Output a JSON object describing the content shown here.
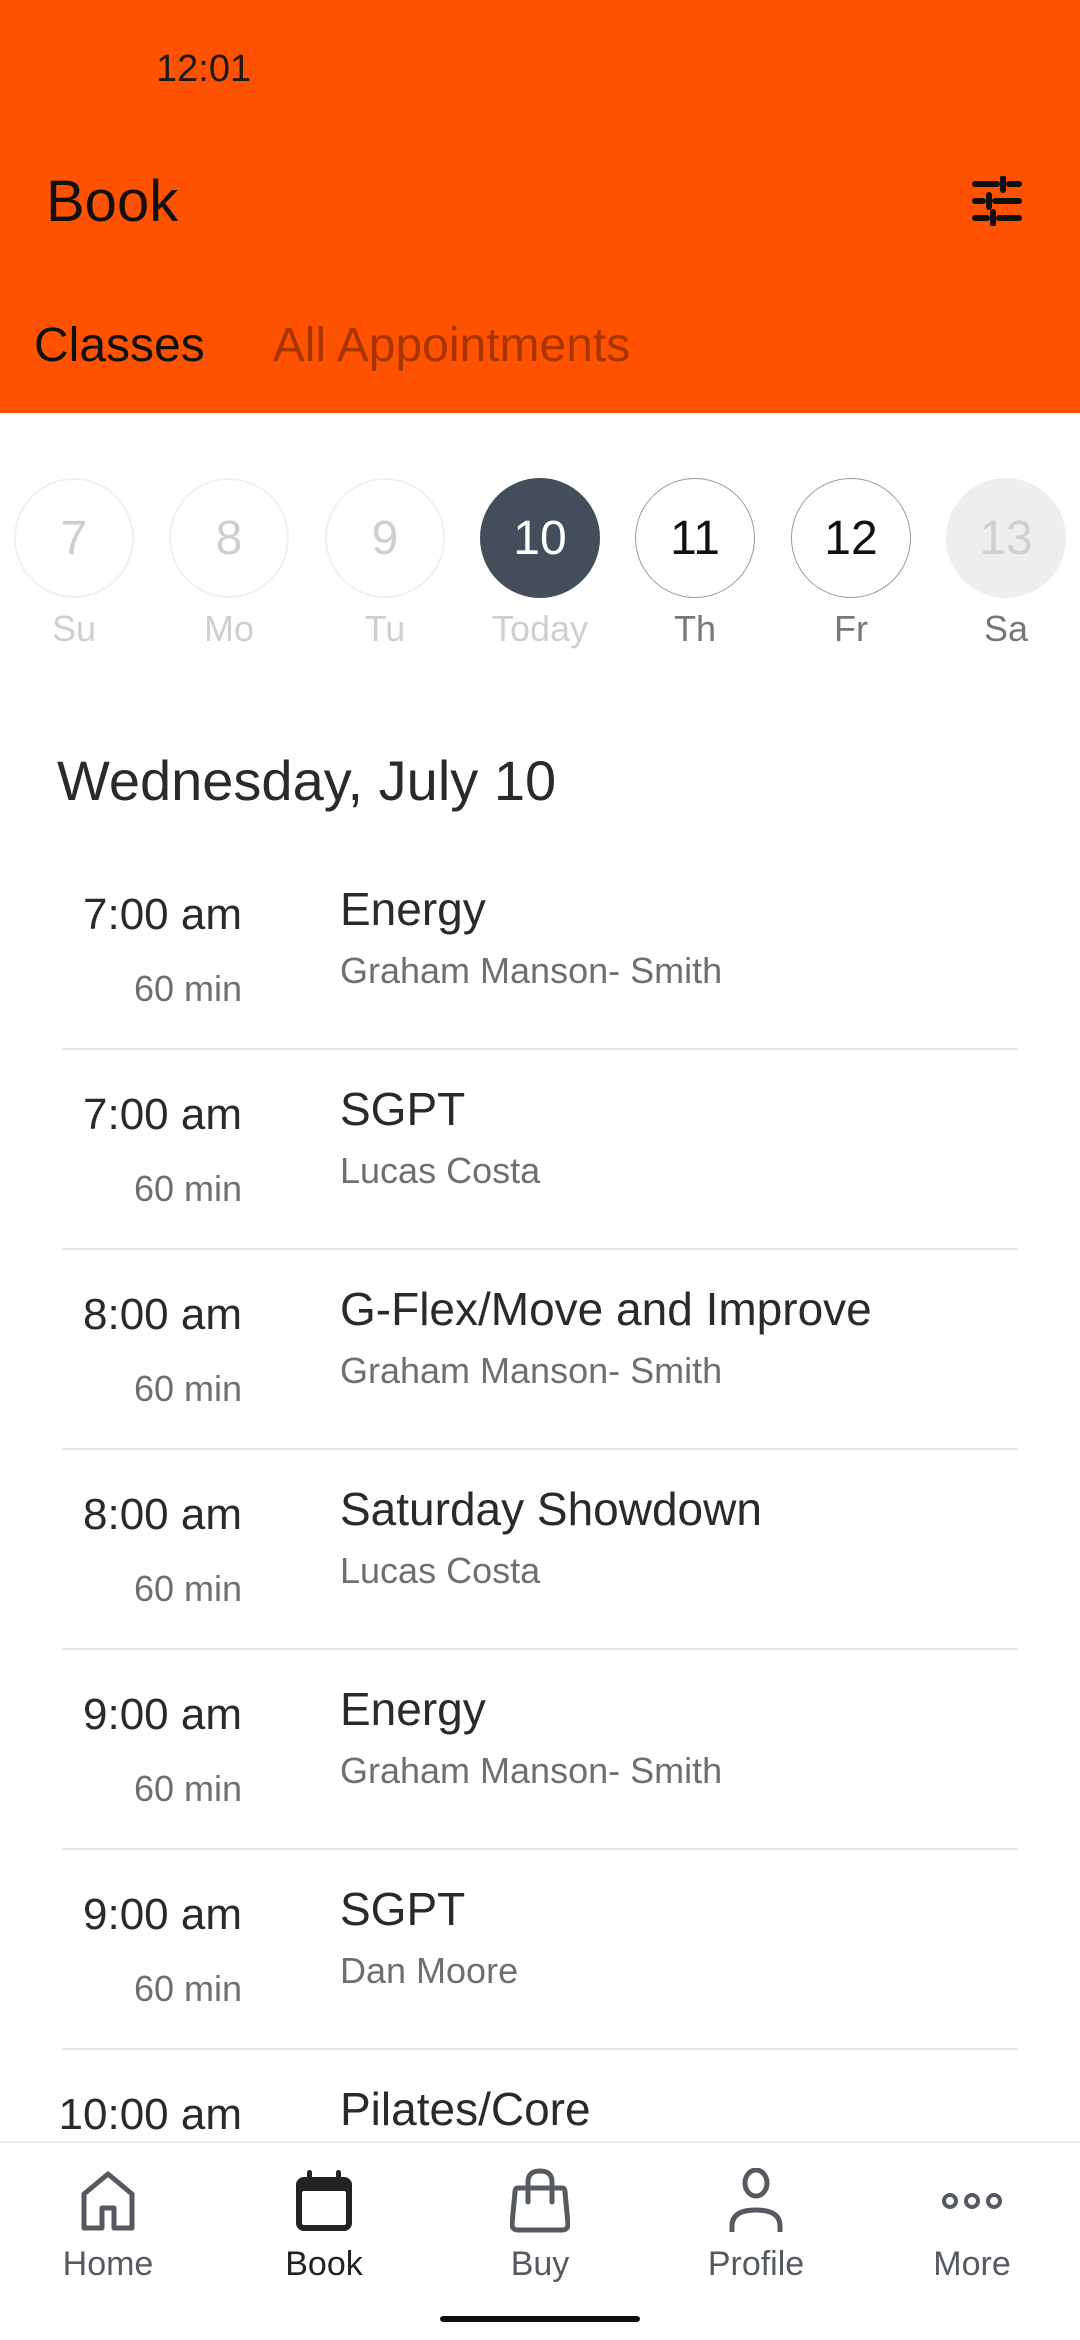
{
  "status_bar": {
    "time": "12:01"
  },
  "header": {
    "title": "Book",
    "filter_icon": "sliders-filter-icon",
    "tabs": [
      {
        "label": "Classes",
        "active": true
      },
      {
        "label": "All Appointments",
        "active": false
      }
    ]
  },
  "colors": {
    "brand": "#ff5200",
    "selected_day": "#434e5a",
    "inactive_tab": "#a83400"
  },
  "date_strip": [
    {
      "number": "7",
      "label": "Su",
      "state": "past"
    },
    {
      "number": "8",
      "label": "Mo",
      "state": "past"
    },
    {
      "number": "9",
      "label": "Tu",
      "state": "past"
    },
    {
      "number": "10",
      "label": "Today",
      "state": "selected"
    },
    {
      "number": "11",
      "label": "Th",
      "state": "future"
    },
    {
      "number": "12",
      "label": "Fr",
      "state": "future"
    },
    {
      "number": "13",
      "label": "Sa",
      "state": "nextweek"
    }
  ],
  "date_heading": "Wednesday, July 10",
  "classes": [
    {
      "time": "7:00 am",
      "duration": "60 min",
      "name": "Energy",
      "instructor": "Graham Manson- Smith"
    },
    {
      "time": "7:00 am",
      "duration": "60 min",
      "name": "SGPT",
      "instructor": "Lucas Costa"
    },
    {
      "time": "8:00 am",
      "duration": "60 min",
      "name": "G-Flex/Move and Improve",
      "instructor": "Graham Manson- Smith"
    },
    {
      "time": "8:00 am",
      "duration": "60 min",
      "name": "Saturday Showdown",
      "instructor": "Lucas Costa"
    },
    {
      "time": "9:00 am",
      "duration": "60 min",
      "name": "Energy",
      "instructor": "Graham Manson- Smith"
    },
    {
      "time": "9:00 am",
      "duration": "60 min",
      "name": "SGPT",
      "instructor": "Dan Moore"
    },
    {
      "time": "10:00 am",
      "duration": "",
      "name": "Pilates/Core",
      "instructor": ""
    }
  ],
  "bottom_nav": [
    {
      "label": "Home",
      "icon": "home-icon",
      "active": false
    },
    {
      "label": "Book",
      "icon": "calendar-icon",
      "active": true
    },
    {
      "label": "Buy",
      "icon": "shopping-bag-icon",
      "active": false
    },
    {
      "label": "Profile",
      "icon": "person-icon",
      "active": false
    },
    {
      "label": "More",
      "icon": "more-dots-icon",
      "active": false
    }
  ]
}
